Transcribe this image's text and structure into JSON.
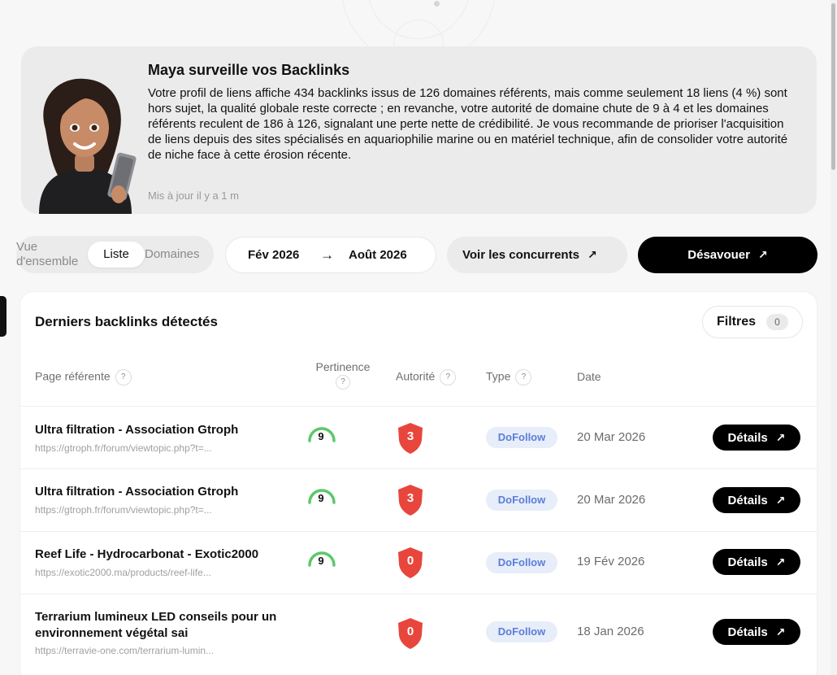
{
  "maya": {
    "title": "Maya surveille vos Backlinks",
    "text": "Votre profil de liens affiche 434 backlinks issus de 126 domaines référents, mais comme seulement 18 liens (4 %) sont hors sujet, la qualité globale reste correcte ; en revanche, votre autorité de domaine chute de 9 à 4 et les domaines référents reculent de 186 à 126, signalant une perte nette de crédibilité. Je vous recommande de prioriser l'acquisition de liens depuis des sites spécialisés en aquariophilie marine ou en matériel technique, afin de consolider votre autorité de niche face à cette érosion récente.",
    "updated": "Mis à jour il y a 1 m"
  },
  "controls": {
    "view_overview": "Vue d'ensemble",
    "view_list": "Liste",
    "view_domains": "Domaines",
    "date_from": "Fév 2026",
    "date_arrow": "→",
    "date_to": "Août 2026",
    "competitors": "Voir les concurrents",
    "disavow": "Désavouer",
    "arrow": "↗"
  },
  "table": {
    "title": "Derniers backlinks détectés",
    "filters_label": "Filtres",
    "filters_count": "0",
    "help": "?",
    "headers": {
      "page": "Page référente",
      "relevance": "Pertinence",
      "authority": "Autorité",
      "type": "Type",
      "date": "Date"
    },
    "details_label": "Détails",
    "rows": [
      {
        "title": "Ultra filtration - Association Gtroph",
        "url": "https://gtroph.fr/forum/viewtopic.php?t=...",
        "relevance": "9",
        "authority": "3",
        "type": "DoFollow",
        "date": "20 Mar 2026"
      },
      {
        "title": "Ultra filtration - Association Gtroph",
        "url": "https://gtroph.fr/forum/viewtopic.php?t=...",
        "relevance": "9",
        "authority": "3",
        "type": "DoFollow",
        "date": "20 Mar 2026"
      },
      {
        "title": "Reef Life - Hydrocarbonat - Exotic2000",
        "url": "https://exotic2000.ma/products/reef-life...",
        "relevance": "9",
        "authority": "0",
        "type": "DoFollow",
        "date": "19 Fév 2026"
      },
      {
        "title": "Terrarium lumineux LED conseils pour un environnement végétal sai",
        "url": "https://terravie-one.com/terrarium-lumin...",
        "relevance": "",
        "authority": "0",
        "type": "DoFollow",
        "date": "18 Jan 2026"
      }
    ]
  },
  "colors": {
    "shield_red": "#e8463c",
    "gauge_green": "#5cc86a",
    "badge_blue": "#5b7ed8"
  }
}
